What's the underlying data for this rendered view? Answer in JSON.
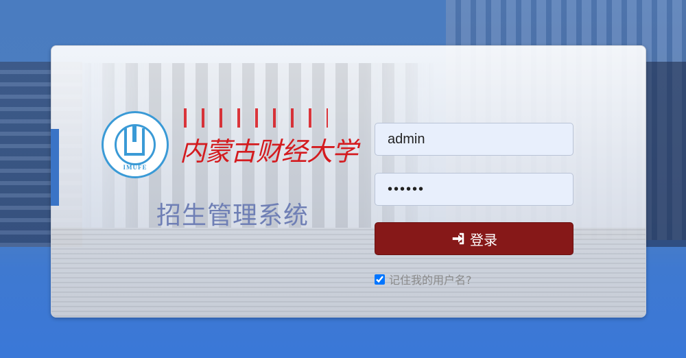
{
  "brand": {
    "seal_text": "IMUFE",
    "university_name": "内蒙古财经大学",
    "system_title": "招生管理系统"
  },
  "form": {
    "username_value": "admin",
    "password_value": "••••••",
    "login_label": "登录",
    "remember_label": "记住我的用户名?",
    "remember_checked": true
  },
  "colors": {
    "login_button": "#861818",
    "accent_blue": "#3a74c6",
    "title_color": "#6f7fb5",
    "university_red": "#d41b1f"
  },
  "icons": {
    "login": "sign-in-icon",
    "remember": "checkbox"
  }
}
